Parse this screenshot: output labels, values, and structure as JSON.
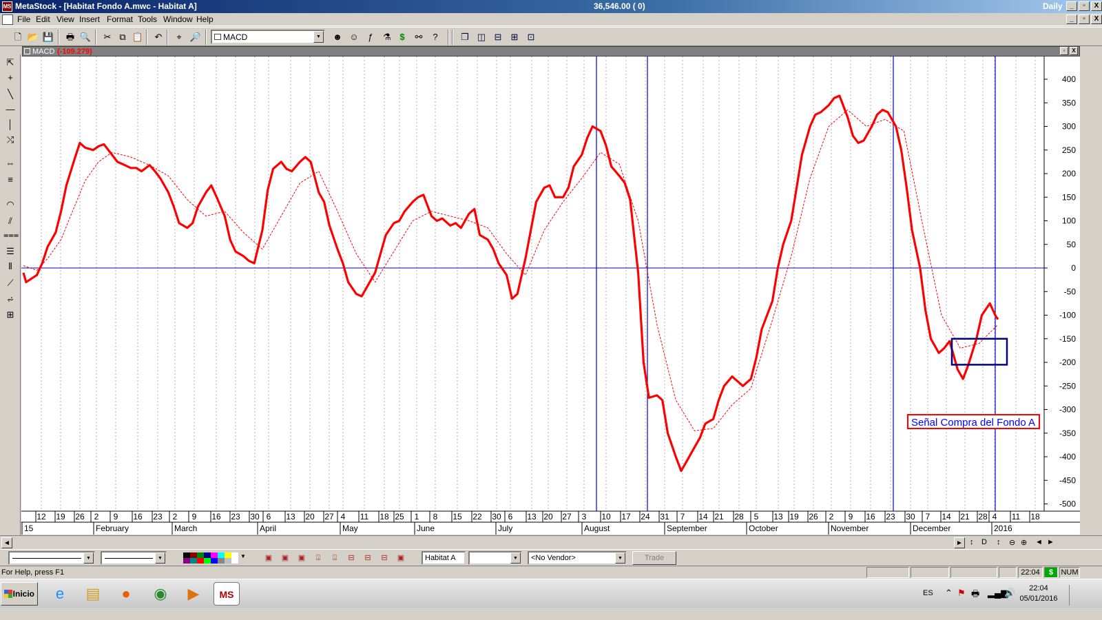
{
  "window": {
    "app_name": "MetaStock",
    "title": "MetaStock - [Habitat Fondo A.mwc - Habitat A]",
    "quote": "36,546.00 ( 0)",
    "period": "Daily",
    "caption_buttons": [
      "_",
      "▫",
      "X"
    ]
  },
  "menu": {
    "items": [
      "File",
      "Edit",
      "View",
      "Insert",
      "Format",
      "Tools",
      "Window",
      "Help"
    ]
  },
  "toolbar": {
    "buttons": [
      {
        "name": "new-icon",
        "glyph": "🗋"
      },
      {
        "name": "open-icon",
        "glyph": "📂"
      },
      {
        "name": "save-icon",
        "glyph": "💾"
      },
      {
        "name": "print-icon",
        "glyph": "🖶"
      },
      {
        "name": "print-preview-icon",
        "glyph": "🔍"
      },
      {
        "name": "cut-icon",
        "glyph": "✂"
      },
      {
        "name": "copy-icon",
        "glyph": "⧉"
      },
      {
        "name": "paste-icon",
        "glyph": "📋"
      },
      {
        "name": "undo-icon",
        "glyph": "↶"
      },
      {
        "name": "crosshair-icon",
        "glyph": "⌖"
      },
      {
        "name": "zoom-icon",
        "glyph": "🔎"
      }
    ],
    "indicator_select": {
      "value": "MACD"
    },
    "buttons2": [
      {
        "name": "expert-advisor-icon",
        "glyph": "☻"
      },
      {
        "name": "explorer-icon",
        "glyph": "☺"
      },
      {
        "name": "formula-icon",
        "glyph": "ƒ"
      },
      {
        "name": "system-tester-icon",
        "glyph": "⚗"
      },
      {
        "name": "dollar-icon",
        "glyph": "$"
      },
      {
        "name": "binoculars-icon",
        "glyph": "⚯"
      },
      {
        "name": "context-help-icon",
        "glyph": "?"
      }
    ],
    "buttons3": [
      {
        "name": "cascade-icon",
        "glyph": "❐"
      },
      {
        "name": "tile-vertical-icon",
        "glyph": "◫"
      },
      {
        "name": "tile-horizontal-icon",
        "glyph": "⊟"
      },
      {
        "name": "tile-grid-icon",
        "glyph": "⊞"
      },
      {
        "name": "arrange-icon",
        "glyph": "⊡"
      }
    ]
  },
  "chart_window": {
    "indicator_name": "MACD",
    "indicator_value": "(-109.279)",
    "side_tools": [
      "pointer-icon",
      "crosshair-tool-icon",
      "trendline-icon",
      "horizontal-line-icon",
      "vertical-line-icon",
      "regression-icon",
      "cycle-lines-icon",
      "speed-lines-icon",
      "fibonacci-arcs-icon",
      "fibonacci-fan-icon",
      "fibonacci-retracement-icon",
      "quadrant-lines-icon",
      "time-zones-icon",
      "gann-fan-icon",
      "gann-grid-icon",
      "pitchfork-icon"
    ]
  },
  "chart_data": {
    "type": "line",
    "y_ticks": [
      400,
      350,
      300,
      250,
      200,
      150,
      100,
      50,
      0,
      -50,
      -100,
      -150,
      -200,
      -250,
      -300,
      -350,
      -400,
      -450,
      -500
    ],
    "ylim": [
      -500,
      400
    ],
    "x_day_ticks": [
      "12",
      "19",
      "26",
      "2",
      "9",
      "16",
      "23",
      "2",
      "9",
      "16",
      "23",
      "30",
      "6",
      "13",
      "20",
      "27",
      "4",
      "11",
      "18",
      "25",
      "1",
      "8",
      "15",
      "22",
      "30",
      "6",
      "13",
      "20",
      "27",
      "3",
      "10",
      "17",
      "24",
      "31",
      "7",
      "14",
      "21",
      "28",
      "5",
      "13",
      "19",
      "26",
      "2",
      "9",
      "16",
      "23",
      "30",
      "7",
      "14",
      "21",
      "28",
      "4",
      "11",
      "18"
    ],
    "x_month_labels": [
      "15",
      "February",
      "March",
      "April",
      "May",
      "June",
      "July",
      "August",
      "September",
      "October",
      "November",
      "December",
      "2016"
    ],
    "horizontal_line": 0,
    "vertical_markers": [
      "Aug 10",
      "Aug 24",
      "Nov 23",
      "Jan 4"
    ],
    "series": [
      {
        "role": "macd",
        "style": "thick solid red",
        "values": [
          [
            "Jan 7",
            -10
          ],
          [
            "Jan 8",
            -30
          ],
          [
            "Jan 12",
            -15
          ],
          [
            "Jan 14",
            10
          ],
          [
            "Jan 16",
            45
          ],
          [
            "Jan 19",
            75
          ],
          [
            "Jan 21",
            120
          ],
          [
            "Jan 23",
            175
          ],
          [
            "Jan 26",
            230
          ],
          [
            "Jan 28",
            265
          ],
          [
            "Jan 30",
            255
          ],
          [
            "Feb 2",
            250
          ],
          [
            "Feb 4",
            258
          ],
          [
            "Feb 6",
            262
          ],
          [
            "Feb 9",
            240
          ],
          [
            "Feb 11",
            225
          ],
          [
            "Feb 13",
            220
          ],
          [
            "Feb 16",
            212
          ],
          [
            "Feb 18",
            212
          ],
          [
            "Feb 20",
            205
          ],
          [
            "Feb 23",
            218
          ],
          [
            "Feb 25",
            205
          ],
          [
            "Feb 27",
            190
          ],
          [
            "Mar 2",
            160
          ],
          [
            "Mar 4",
            130
          ],
          [
            "Mar 6",
            95
          ],
          [
            "Mar 9",
            85
          ],
          [
            "Mar 11",
            95
          ],
          [
            "Mar 13",
            130
          ],
          [
            "Mar 16",
            160
          ],
          [
            "Mar 18",
            175
          ],
          [
            "Mar 20",
            150
          ],
          [
            "Mar 23",
            110
          ],
          [
            "Mar 25",
            60
          ],
          [
            "Mar 27",
            35
          ],
          [
            "Mar 30",
            25
          ],
          [
            "Apr 1",
            15
          ],
          [
            "Apr 3",
            10
          ],
          [
            "Apr 6",
            80
          ],
          [
            "Apr 8",
            165
          ],
          [
            "Apr 10",
            210
          ],
          [
            "Apr 13",
            225
          ],
          [
            "Apr 15",
            210
          ],
          [
            "Apr 17",
            205
          ],
          [
            "Apr 20",
            225
          ],
          [
            "Apr 22",
            235
          ],
          [
            "Apr 24",
            225
          ],
          [
            "Apr 27",
            160
          ],
          [
            "Apr 29",
            140
          ],
          [
            "May 1",
            90
          ],
          [
            "May 4",
            40
          ],
          [
            "May 6",
            10
          ],
          [
            "May 8",
            -30
          ],
          [
            "May 11",
            -55
          ],
          [
            "May 13",
            -60
          ],
          [
            "May 15",
            -40
          ],
          [
            "May 18",
            -10
          ],
          [
            "May 20",
            30
          ],
          [
            "May 22",
            70
          ],
          [
            "May 25",
            95
          ],
          [
            "May 27",
            100
          ],
          [
            "May 29",
            120
          ],
          [
            "Jun 1",
            140
          ],
          [
            "Jun 3",
            150
          ],
          [
            "Jun 5",
            155
          ],
          [
            "Jun 8",
            110
          ],
          [
            "Jun 10",
            100
          ],
          [
            "Jun 12",
            105
          ],
          [
            "Jun 15",
            90
          ],
          [
            "Jun 17",
            95
          ],
          [
            "Jun 19",
            85
          ],
          [
            "Jun 22",
            115
          ],
          [
            "Jun 24",
            125
          ],
          [
            "Jun 26",
            70
          ],
          [
            "Jun 29",
            60
          ],
          [
            "Jul 1",
            40
          ],
          [
            "Jul 3",
            10
          ],
          [
            "Jul 6",
            -15
          ],
          [
            "Jul 8",
            -65
          ],
          [
            "Jul 10",
            -55
          ],
          [
            "Jul 13",
            20
          ],
          [
            "Jul 15",
            80
          ],
          [
            "Jul 17",
            140
          ],
          [
            "Jul 20",
            170
          ],
          [
            "Jul 22",
            175
          ],
          [
            "Jul 24",
            150
          ],
          [
            "Jul 27",
            150
          ],
          [
            "Jul 29",
            170
          ],
          [
            "Jul 31",
            215
          ],
          [
            "Aug 3",
            240
          ],
          [
            "Aug 5",
            275
          ],
          [
            "Aug 7",
            300
          ],
          [
            "Aug 10",
            290
          ],
          [
            "Aug 12",
            260
          ],
          [
            "Aug 14",
            215
          ],
          [
            "Aug 17",
            195
          ],
          [
            "Aug 19",
            180
          ],
          [
            "Aug 21",
            145
          ],
          [
            "Aug 24",
            -10
          ],
          [
            "Aug 26",
            -200
          ],
          [
            "Aug 28",
            -275
          ],
          [
            "Aug 31",
            -270
          ],
          [
            "Sep 2",
            -280
          ],
          [
            "Sep 4",
            -350
          ],
          [
            "Sep 7",
            -400
          ],
          [
            "Sep 9",
            -430
          ],
          [
            "Sep 11",
            -410
          ],
          [
            "Sep 14",
            -380
          ],
          [
            "Sep 16",
            -360
          ],
          [
            "Sep 18",
            -330
          ],
          [
            "Sep 21",
            -320
          ],
          [
            "Sep 23",
            -280
          ],
          [
            "Sep 25",
            -250
          ],
          [
            "Sep 28",
            -230
          ],
          [
            "Sep 30",
            -240
          ],
          [
            "Oct 2",
            -250
          ],
          [
            "Oct 5",
            -235
          ],
          [
            "Oct 7",
            -190
          ],
          [
            "Oct 9",
            -130
          ],
          [
            "Oct 13",
            -70
          ],
          [
            "Oct 15",
            0
          ],
          [
            "Oct 17",
            50
          ],
          [
            "Oct 20",
            100
          ],
          [
            "Oct 22",
            170
          ],
          [
            "Oct 24",
            240
          ],
          [
            "Oct 27",
            300
          ],
          [
            "Oct 29",
            325
          ],
          [
            "Oct 31",
            330
          ],
          [
            "Nov 3",
            345
          ],
          [
            "Nov 5",
            360
          ],
          [
            "Nov 7",
            365
          ],
          [
            "Nov 10",
            320
          ],
          [
            "Nov 12",
            280
          ],
          [
            "Nov 14",
            265
          ],
          [
            "Nov 16",
            270
          ],
          [
            "Nov 19",
            300
          ],
          [
            "Nov 21",
            325
          ],
          [
            "Nov 23",
            335
          ],
          [
            "Nov 25",
            330
          ],
          [
            "Nov 28",
            300
          ],
          [
            "Nov 30",
            250
          ],
          [
            "Dec 2",
            170
          ],
          [
            "Dec 4",
            80
          ],
          [
            "Dec 7",
            0
          ],
          [
            "Dec 9",
            -90
          ],
          [
            "Dec 11",
            -150
          ],
          [
            "Dec 14",
            -180
          ],
          [
            "Dec 16",
            -170
          ],
          [
            "Dec 18",
            -155
          ],
          [
            "Dec 21",
            -215
          ],
          [
            "Dec 23",
            -235
          ],
          [
            "Dec 25",
            -205
          ],
          [
            "Dec 28",
            -150
          ],
          [
            "Dec 30",
            -100
          ],
          [
            "Jan 2",
            -75
          ],
          [
            "Jan 4",
            -100
          ],
          [
            "Jan 5",
            -109
          ]
        ]
      },
      {
        "role": "signal",
        "style": "thin dotted red",
        "values": [
          [
            "Jan 7",
            5
          ],
          [
            "Jan 12",
            -5
          ],
          [
            "Jan 16",
            20
          ],
          [
            "Jan 21",
            60
          ],
          [
            "Jan 26",
            130
          ],
          [
            "Jan 30",
            185
          ],
          [
            "Feb 4",
            225
          ],
          [
            "Feb 9",
            245
          ],
          [
            "Feb 16",
            235
          ],
          [
            "Feb 23",
            218
          ],
          [
            "Mar 2",
            195
          ],
          [
            "Mar 9",
            145
          ],
          [
            "Mar 16",
            110
          ],
          [
            "Mar 23",
            120
          ],
          [
            "Mar 30",
            75
          ],
          [
            "Apr 6",
            40
          ],
          [
            "Apr 13",
            110
          ],
          [
            "Apr 20",
            180
          ],
          [
            "Apr 27",
            205
          ],
          [
            "May 4",
            120
          ],
          [
            "May 11",
            30
          ],
          [
            "May 18",
            -30
          ],
          [
            "May 25",
            35
          ],
          [
            "Jun 1",
            100
          ],
          [
            "Jun 8",
            120
          ],
          [
            "Jun 15",
            110
          ],
          [
            "Jun 22",
            100
          ],
          [
            "Jun 29",
            85
          ],
          [
            "Jul 6",
            30
          ],
          [
            "Jul 13",
            -15
          ],
          [
            "Jul 20",
            80
          ],
          [
            "Jul 27",
            140
          ],
          [
            "Aug 3",
            190
          ],
          [
            "Aug 10",
            245
          ],
          [
            "Aug 17",
            220
          ],
          [
            "Aug 24",
            100
          ],
          [
            "Aug 31",
            -120
          ],
          [
            "Sep 7",
            -280
          ],
          [
            "Sep 14",
            -345
          ],
          [
            "Sep 21",
            -340
          ],
          [
            "Sep 28",
            -290
          ],
          [
            "Oct 5",
            -255
          ],
          [
            "Oct 13",
            -110
          ],
          [
            "Oct 20",
            25
          ],
          [
            "Oct 27",
            190
          ],
          [
            "Nov 3",
            300
          ],
          [
            "Nov 10",
            335
          ],
          [
            "Nov 17",
            300
          ],
          [
            "Nov 24",
            315
          ],
          [
            "Dec 1",
            290
          ],
          [
            "Dec 8",
            90
          ],
          [
            "Dec 15",
            -100
          ],
          [
            "Dec 22",
            -170
          ],
          [
            "Dec 29",
            -160
          ],
          [
            "Jan 5",
            -120
          ]
        ]
      }
    ],
    "annotations": [
      {
        "type": "rectangle",
        "x_range": [
          "Dec 16",
          "Jan 5"
        ],
        "y_range": [
          -205,
          -150
        ],
        "color": "#000080"
      },
      {
        "type": "text_box",
        "text": "Señal Compra del Fondo A",
        "text_color": "#0000ff",
        "border_color": "#ff0000"
      }
    ]
  },
  "scroll_nav": {
    "buttons": [
      "◄",
      "►",
      "↕",
      "D",
      "↕",
      "⊖",
      "⊕",
      "◄",
      "►"
    ]
  },
  "bottom_toolbar": {
    "security": "Habitat A",
    "period_combo": "",
    "vendor": "<No Vendor>",
    "trade_label": "Trade"
  },
  "statusbar": {
    "help_text": "For Help, press F1",
    "time": "22:04",
    "dollar": "$",
    "num": "NUM"
  },
  "taskbar": {
    "start_label": "Inicio",
    "apps": [
      {
        "name": "internet-explorer-icon",
        "glyph": "e",
        "color": "#1e90ff"
      },
      {
        "name": "file-explorer-icon",
        "glyph": "▤",
        "color": "#d8a020"
      },
      {
        "name": "firefox-icon",
        "glyph": "●",
        "color": "#e66000"
      },
      {
        "name": "chrome-icon",
        "glyph": "◉",
        "color": "#2a8a2a"
      },
      {
        "name": "media-player-icon",
        "glyph": "▶",
        "color": "#e07010"
      },
      {
        "name": "metastock-icon",
        "glyph": "MS",
        "color": "#b00000"
      }
    ],
    "tray": {
      "language": "ES",
      "time": "22:04",
      "date": "05/01/2016"
    }
  }
}
